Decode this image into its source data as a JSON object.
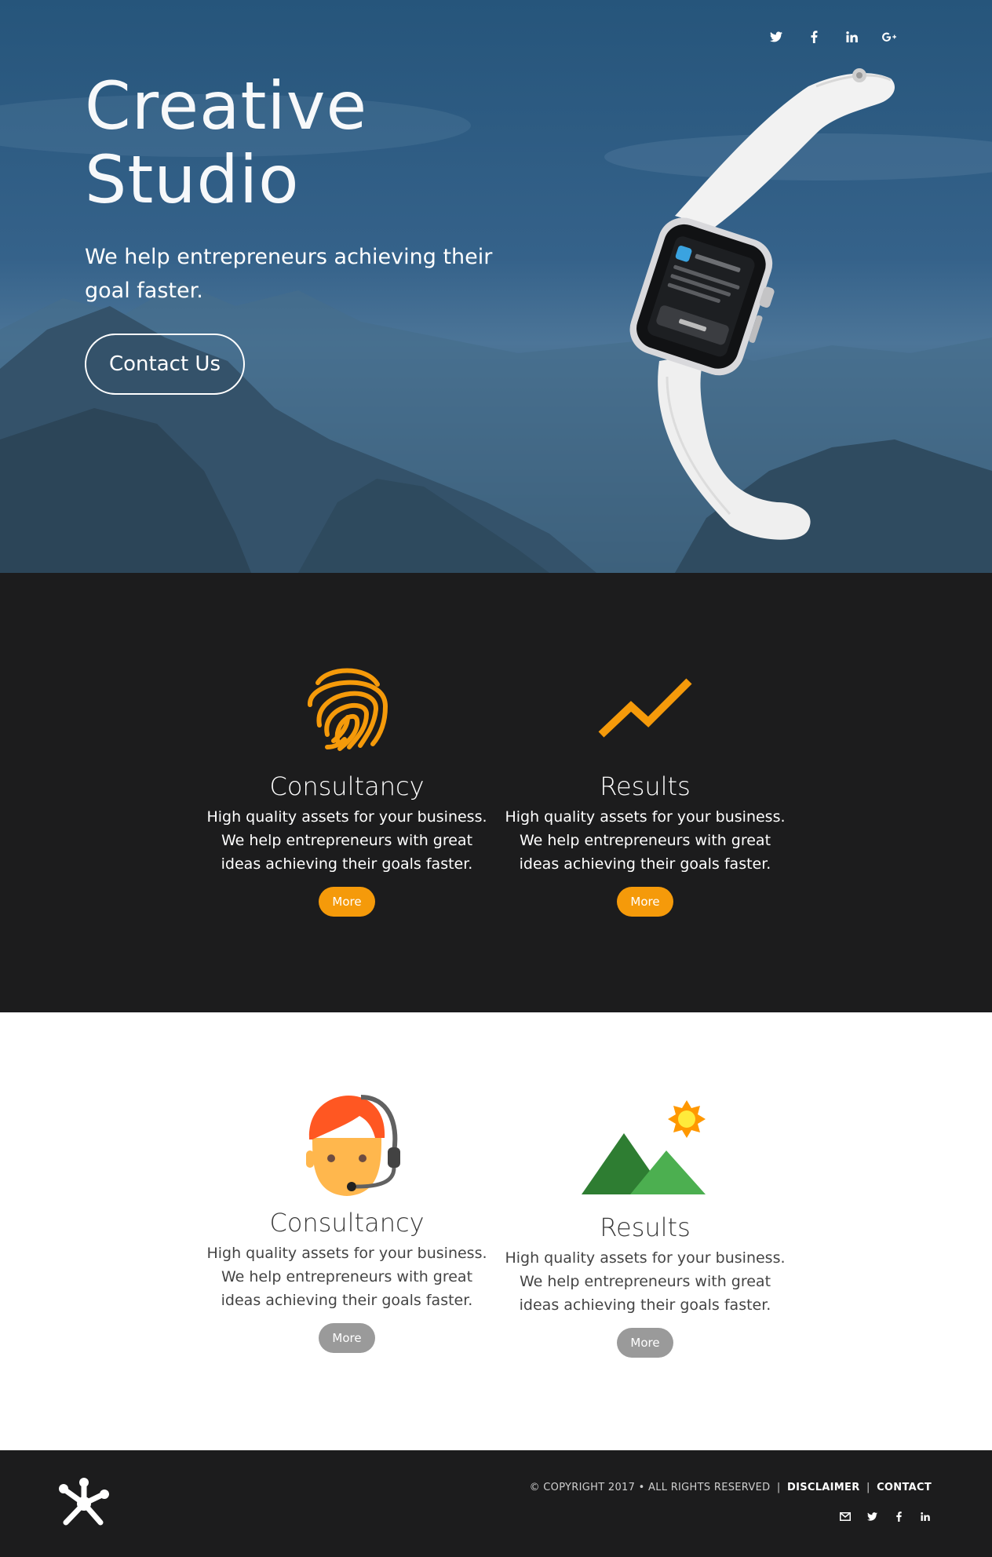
{
  "social": {
    "twitter": "twitter-icon",
    "facebook": "facebook-icon",
    "linkedin": "linkedin-icon",
    "googleplus": "google-plus-icon"
  },
  "hero": {
    "title_line1": "Creative",
    "title_line2": "Studio",
    "subtitle": "We help entrepreneurs achieving their goal faster.",
    "cta_label": "Contact Us"
  },
  "dark_features": [
    {
      "icon": "fingerprint-icon",
      "title": "Consultancy",
      "text": "High quality assets for your business. We help entrepreneurs with great ideas achieving their goals faster.",
      "button": "More"
    },
    {
      "icon": "trend-up-icon",
      "title": "Results",
      "text": "High quality assets for your business. We help entrepreneurs with great ideas achieving their goals faster.",
      "button": "More"
    }
  ],
  "light_features": [
    {
      "icon": "support-agent-icon",
      "title": "Consultancy",
      "text": "High quality assets for your business. We help entrepreneurs with great ideas achieving their goals faster.",
      "button": "More"
    },
    {
      "icon": "mountain-sun-icon",
      "title": "Results",
      "text": "High quality assets for your business. We help entrepreneurs with great ideas achieving their goals faster.",
      "button": "More"
    }
  ],
  "footer": {
    "copyright": "© COPYRIGHT 2017 • ALL RIGHTS RESERVED",
    "disclaimer": "DISCLAIMER",
    "contact": "CONTACT",
    "separator": "|"
  },
  "colors": {
    "accent": "#f59a0a",
    "dark_bg": "#1c1c1d",
    "grey_button": "#9a9a9a"
  }
}
